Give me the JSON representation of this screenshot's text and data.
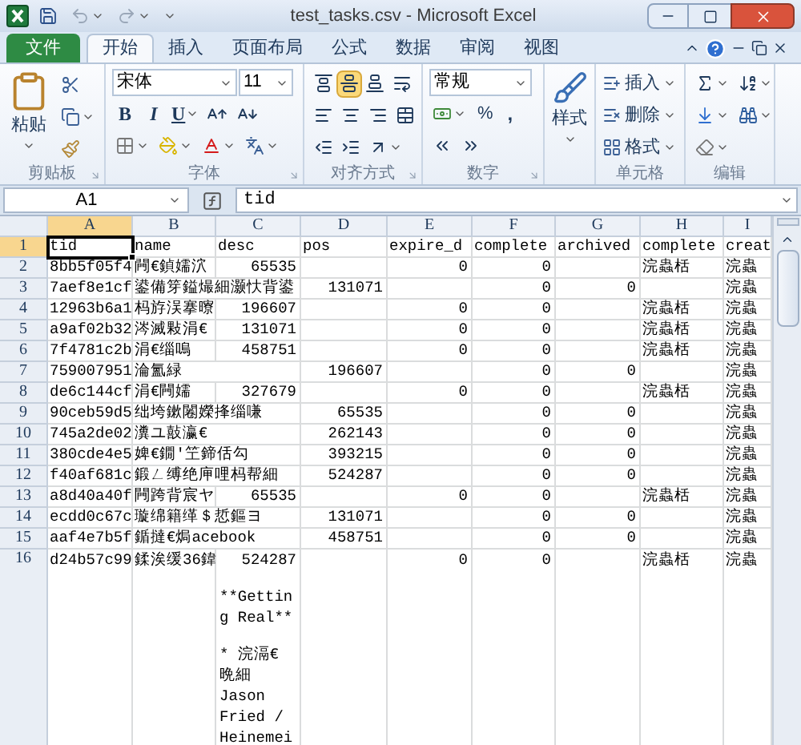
{
  "window": {
    "title": "test_tasks.csv - Microsoft Excel"
  },
  "ribbon_tabs": [
    {
      "label": "文件",
      "kind": "file",
      "selected": false
    },
    {
      "label": "开始",
      "kind": "tab",
      "selected": true
    },
    {
      "label": "插入",
      "kind": "tab",
      "selected": false
    },
    {
      "label": "页面布局",
      "kind": "tab",
      "selected": false
    },
    {
      "label": "公式",
      "kind": "tab",
      "selected": false
    },
    {
      "label": "数据",
      "kind": "tab",
      "selected": false
    },
    {
      "label": "审阅",
      "kind": "tab",
      "selected": false
    },
    {
      "label": "视图",
      "kind": "tab",
      "selected": false
    }
  ],
  "ribbon_groups": [
    {
      "kind": "clipboard",
      "label": "剪贴板",
      "paste": "粘贴"
    },
    {
      "kind": "font",
      "label": "字体",
      "font_name": "宋体",
      "font_size": "11",
      "bold": "B",
      "italic": "I",
      "underline": "U"
    },
    {
      "kind": "alignment",
      "label": "对齐方式",
      "vertical_alignment": [
        {
          "selected": false
        },
        {
          "selected": true
        },
        {
          "selected": false
        }
      ]
    },
    {
      "kind": "number",
      "label": "数字",
      "format": "常规",
      "percent": "%",
      "comma": ","
    },
    {
      "kind": "styles",
      "button": "样式"
    },
    {
      "kind": "cells",
      "label": "单元格",
      "buttons": [
        "插入",
        "删除",
        "格式"
      ]
    },
    {
      "kind": "editing",
      "label": "编辑"
    }
  ],
  "formula_bar": {
    "name_box": "A1",
    "value": "tid"
  },
  "sheet": {
    "columns": [
      {
        "label": "A",
        "selected": true
      },
      {
        "label": "B",
        "selected": false
      },
      {
        "label": "C",
        "selected": false
      },
      {
        "label": "D",
        "selected": false
      },
      {
        "label": "E",
        "selected": false
      },
      {
        "label": "F",
        "selected": false
      },
      {
        "label": "G",
        "selected": false
      },
      {
        "label": "H",
        "selected": false
      },
      {
        "label": "I",
        "selected": false
      }
    ],
    "rows": [
      {
        "number": "1",
        "selected": true,
        "cells": [
          {
            "text": "tid",
            "kind": "text"
          },
          {
            "text": "name",
            "kind": "text"
          },
          {
            "text": "desc",
            "kind": "text"
          },
          {
            "text": "pos",
            "kind": "text"
          },
          {
            "text": "expire_d",
            "kind": "text"
          },
          {
            "text": "complete",
            "kind": "text"
          },
          {
            "text": "archived",
            "kind": "text"
          },
          {
            "text": "complete",
            "kind": "text"
          },
          {
            "text": "creat",
            "kind": "text"
          }
        ]
      },
      {
        "number": "2",
        "selected": false,
        "cells": [
          {
            "text": "8bb5f05f4",
            "kind": "text"
          },
          {
            "text": "闁€鍞嬬泬",
            "kind": "text"
          },
          {
            "text": "65535",
            "kind": "number"
          },
          null,
          {
            "text": "0",
            "kind": "number"
          },
          {
            "text": "0",
            "kind": "number"
          },
          null,
          {
            "text": "浣蟲栝",
            "kind": "text"
          },
          {
            "text": "浣蟲",
            "kind": "text"
          }
        ]
      },
      {
        "number": "3",
        "selected": false,
        "cells": [
          {
            "text": "7aef8e1cf",
            "kind": "text"
          },
          {
            "text": "鍙備笌鎰熶細灏忕背鍙",
            "kind": "text"
          },
          null,
          {
            "text": "131071",
            "kind": "number"
          },
          null,
          {
            "text": "0",
            "kind": "number"
          },
          {
            "text": "0",
            "kind": "number"
          },
          null,
          {
            "text": "浣蟲",
            "kind": "text"
          }
        ]
      },
      {
        "number": "4",
        "selected": false,
        "cells": [
          {
            "text": "12963b6a1",
            "kind": "text"
          },
          {
            "text": "杩斿洖搴曢",
            "kind": "text"
          },
          {
            "text": "196607",
            "kind": "number"
          },
          null,
          {
            "text": "0",
            "kind": "number"
          },
          {
            "text": "0",
            "kind": "number"
          },
          null,
          {
            "text": "浣蟲栝",
            "kind": "text"
          },
          {
            "text": "浣蟲",
            "kind": "text"
          }
        ]
      },
      {
        "number": "5",
        "selected": false,
        "cells": [
          {
            "text": "a9af02b32",
            "kind": "text"
          },
          {
            "text": "涔滅敤涓€",
            "kind": "text"
          },
          {
            "text": "131071",
            "kind": "number"
          },
          null,
          {
            "text": "0",
            "kind": "number"
          },
          {
            "text": "0",
            "kind": "number"
          },
          null,
          {
            "text": "浣蟲栝",
            "kind": "text"
          },
          {
            "text": "浣蟲",
            "kind": "text"
          }
        ]
      },
      {
        "number": "6",
        "selected": false,
        "cells": [
          {
            "text": "7f4781c2b",
            "kind": "text"
          },
          {
            "text": "涓€缁嗚",
            "kind": "text"
          },
          {
            "text": "458751",
            "kind": "number"
          },
          null,
          {
            "text": "0",
            "kind": "number"
          },
          {
            "text": "0",
            "kind": "number"
          },
          null,
          {
            "text": "浣蟲栝",
            "kind": "text"
          },
          {
            "text": "浣蟲",
            "kind": "text"
          }
        ]
      },
      {
        "number": "7",
        "selected": false,
        "cells": [
          {
            "text": "759007951",
            "kind": "text"
          },
          {
            "text": "淪氳緑",
            "kind": "text"
          },
          null,
          {
            "text": "196607",
            "kind": "number"
          },
          null,
          {
            "text": "0",
            "kind": "number"
          },
          {
            "text": "0",
            "kind": "number"
          },
          null,
          {
            "text": "浣蟲",
            "kind": "text"
          }
        ]
      },
      {
        "number": "8",
        "selected": false,
        "cells": [
          {
            "text": "de6c144cf",
            "kind": "text"
          },
          {
            "text": "涓€闁嬬",
            "kind": "text"
          },
          {
            "text": "327679",
            "kind": "number"
          },
          null,
          {
            "text": "0",
            "kind": "number"
          },
          {
            "text": "0",
            "kind": "number"
          },
          null,
          {
            "text": "浣蟲栝",
            "kind": "text"
          },
          {
            "text": "浣蟲",
            "kind": "text"
          }
        ]
      },
      {
        "number": "9",
        "selected": false,
        "cells": [
          {
            "text": "90ceb59d5",
            "kind": "text"
          },
          {
            "text": "绌垮鏉闂嬫捀缁嗛",
            "kind": "text"
          },
          null,
          {
            "text": "65535",
            "kind": "number"
          },
          null,
          {
            "text": "0",
            "kind": "number"
          },
          {
            "text": "0",
            "kind": "number"
          },
          null,
          {
            "text": "浣蟲",
            "kind": "text"
          }
        ]
      },
      {
        "number": "10",
        "selected": false,
        "cells": [
          {
            "text": "745a2de02",
            "kind": "text"
          },
          {
            "text": "瀵ユ敼瀛€",
            "kind": "text"
          },
          null,
          {
            "text": "262143",
            "kind": "number"
          },
          null,
          {
            "text": "0",
            "kind": "number"
          },
          {
            "text": "0",
            "kind": "number"
          },
          null,
          {
            "text": "浣蟲",
            "kind": "text"
          }
        ]
      },
      {
        "number": "11",
        "selected": false,
        "cells": [
          {
            "text": "380cde4e5",
            "kind": "text"
          },
          {
            "text": "婢€鐗′笁鍗佸勾",
            "kind": "text"
          },
          null,
          {
            "text": "393215",
            "kind": "number"
          },
          null,
          {
            "text": "0",
            "kind": "number"
          },
          {
            "text": "0",
            "kind": "number"
          },
          null,
          {
            "text": "浣蟲",
            "kind": "text"
          }
        ]
      },
      {
        "number": "12",
        "selected": false,
        "cells": [
          {
            "text": "f40af681c",
            "kind": "text"
          },
          {
            "text": "鍛ㄥ缚绝庘哩杩帮細",
            "kind": "text"
          },
          null,
          {
            "text": "524287",
            "kind": "number"
          },
          null,
          {
            "text": "0",
            "kind": "number"
          },
          {
            "text": "0",
            "kind": "number"
          },
          null,
          {
            "text": "浣蟲",
            "kind": "text"
          }
        ]
      },
      {
        "number": "13",
        "selected": false,
        "cells": [
          {
            "text": "a8d40a40f",
            "kind": "text"
          },
          {
            "text": "闁跨背宸ヤ",
            "kind": "text"
          },
          {
            "text": "65535",
            "kind": "number"
          },
          null,
          {
            "text": "0",
            "kind": "number"
          },
          {
            "text": "0",
            "kind": "number"
          },
          null,
          {
            "text": "浣蟲栝",
            "kind": "text"
          },
          {
            "text": "浣蟲",
            "kind": "text"
          }
        ]
      },
      {
        "number": "14",
        "selected": false,
        "cells": [
          {
            "text": "ecdd0c67c",
            "kind": "text"
          },
          {
            "text": "璇绵籍缂＄悊鏂ヨ",
            "kind": "text"
          },
          null,
          {
            "text": "131071",
            "kind": "number"
          },
          null,
          {
            "text": "0",
            "kind": "number"
          },
          {
            "text": "0",
            "kind": "number"
          },
          null,
          {
            "text": "浣蟲",
            "kind": "text"
          }
        ]
      },
      {
        "number": "15",
        "selected": false,
        "cells": [
          {
            "text": "aaf4e7b5f",
            "kind": "text"
          },
          {
            "text": "鍎撻€焗acebook",
            "kind": "text"
          },
          null,
          {
            "text": "458751",
            "kind": "number"
          },
          null,
          {
            "text": "0",
            "kind": "number"
          },
          {
            "text": "0",
            "kind": "number"
          },
          null,
          {
            "text": "浣蟲",
            "kind": "text"
          }
        ]
      },
      {
        "number": "16",
        "selected": false,
        "cells": [
          {
            "text": "d24b57c99",
            "kind": "text"
          },
          {
            "text": "鍒涘缓36鍏",
            "kind": "text"
          },
          {
            "text": "524287",
            "kind": "wrapped",
            "paragraphs": [
              [
                "**Gettin",
                "g Real**"
              ],
              [
                "* 浣滆€",
                "晩細",
                "Jason",
                "Fried /",
                "Heinemei"
              ]
            ]
          },
          null,
          {
            "text": "0",
            "kind": "number"
          },
          {
            "text": "0",
            "kind": "number"
          },
          null,
          {
            "text": "浣蟲栝",
            "kind": "text"
          },
          {
            "text": "浣蟲",
            "kind": "text"
          }
        ]
      }
    ]
  }
}
